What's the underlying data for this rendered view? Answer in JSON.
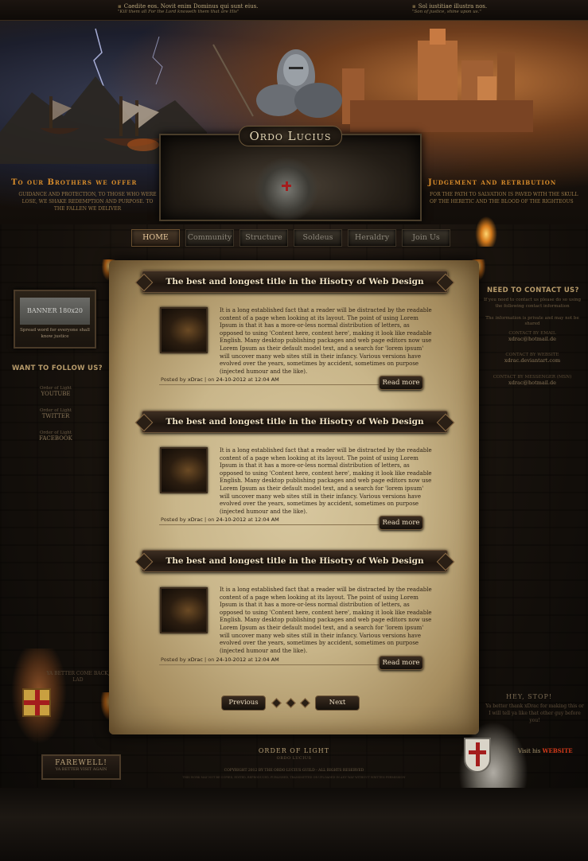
{
  "top_quotes": {
    "left": {
      "latin": "Caedite eos. Novit enim Dominus qui sunt eius.",
      "english": "\"Kill them all For the Lord knoweth them that are His\""
    },
    "right": {
      "latin": "Sol iustitiae illustra nos.",
      "english": "\"Son of justice, shine upon us.\""
    }
  },
  "logo": {
    "text": "Ordo Lucius"
  },
  "taglines": {
    "left": {
      "title": "To our Brothers we offer",
      "text": "Guidance and protection, to those who were lose, we shake redemption and purpose. To the fallen we deliver"
    },
    "right": {
      "title": "Judgement and retribution",
      "text": "For the path to salvation is paved with the skull of the heretic and the blood of the righteous"
    }
  },
  "nav": {
    "items": [
      {
        "label": "HOME",
        "active": true
      },
      {
        "label": "Community",
        "active": false
      },
      {
        "label": "Structure",
        "active": false
      },
      {
        "label": "Soldeus",
        "active": false
      },
      {
        "label": "Heraldry",
        "active": false
      },
      {
        "label": "Join Us",
        "active": false
      }
    ]
  },
  "posts": [
    {
      "title": "The best and longest title in the Hisotry of Web Design",
      "body": "It is a long established fact that a reader will be distracted by the readable content of a page when looking at its layout. The point of using Lorem Ipsum is that it has a more-or-less normal distribution of letters, as opposed to using 'Content here, content here', making it look like readable English. Many desktop publishing packages and web page editors now use Lorem Ipsum as their default model text, and a search for 'lorem ipsum' will uncover many web sites still in their infancy. Various versions have evolved over the years, sometimes by accident, sometimes on purpose (injected humour and the like).",
      "posted_by_label": "Posted by",
      "author": "xDrac",
      "on_label": "on",
      "date": "24-10-2012",
      "at_label": "at",
      "time": "12:04 AM",
      "read_more": "Read more"
    },
    {
      "title": "The best and longest title in the Hisotry of Web Design",
      "body": "It is a long established fact that a reader will be distracted by the readable content of a page when looking at its layout. The point of using Lorem Ipsum is that it has a more-or-less normal distribution of letters, as opposed to using 'Content here, content here', making it look like readable English. Many desktop publishing packages and web page editors now use Lorem Ipsum as their default model text, and a search for 'lorem ipsum' will uncover many web sites still in their infancy. Various versions have evolved over the years, sometimes by accident, sometimes on purpose (injected humour and the like).",
      "posted_by_label": "Posted by",
      "author": "xDrac",
      "on_label": "on",
      "date": "24-10-2012",
      "at_label": "at",
      "time": "12:04 AM",
      "read_more": "Read more"
    },
    {
      "title": "The best and longest title in the Hisotry of Web Design",
      "body": "It is a long established fact that a reader will be distracted by the readable content of a page when looking at its layout. The point of using Lorem Ipsum is that it has a more-or-less normal distribution of letters, as opposed to using 'Content here, content here', making it look like readable English. Many desktop publishing packages and web page editors now use Lorem Ipsum as their default model text, and a search for 'lorem ipsum' will uncover many web sites still in their infancy. Various versions have evolved over the years, sometimes by accident, sometimes on purpose (injected humour and the like).",
      "posted_by_label": "Posted by",
      "author": "xDrac",
      "on_label": "on",
      "date": "24-10-2012",
      "at_label": "at",
      "time": "12:04 AM",
      "read_more": "Read more"
    }
  ],
  "pagination": {
    "previous": "Previous",
    "next": "Next"
  },
  "left_sidebar": {
    "banner": {
      "label": "BANNER 180x20",
      "text": "Spread word for everyone shall know justice"
    },
    "follow_title": "WANT TO FOLLOW US?",
    "follow_items": [
      {
        "small": "Order of Light",
        "big": "YOUTUBE"
      },
      {
        "small": "Order of Light",
        "big": "TWITTER"
      },
      {
        "small": "Order of Light",
        "big": "FACEBOOK"
      }
    ],
    "better_text": "Ya better come back, lad",
    "farewell": {
      "title": "FAREWELL!",
      "sub": "Ya better visit again"
    }
  },
  "right_sidebar": {
    "contact_title": "NEED TO CONTACT US?",
    "contact_info": "If you need to contact us please do so using the following contact information",
    "contact_note": "The information is private and may not be shared",
    "contacts": [
      {
        "label": "Contact by email",
        "value": "xdrac@hotmail.de"
      },
      {
        "label": "Contact by website",
        "value": "xdrac.deviantart.com"
      },
      {
        "label": "Contact by messenger (MSN)",
        "value": "xdrac@hotmail.de"
      }
    ],
    "stop_title": "HEY, STOP!",
    "stop_text": "Ya better thank xDrac for making this or I will tell ya like that other guy before you!",
    "visit_prefix": "Visit his",
    "visit_link": "WEBSITE"
  },
  "footer": {
    "title": "ORDER OF LIGHT",
    "subtitle": "Ordo Lucius",
    "copyright": "Copyright 2012 by the Ordo Lucius Guild - All rights reserved",
    "legal": "This work may not be copied, edited, reproduced, published, transmitted or uploaded in any way without written permission"
  },
  "colors": {
    "accent": "#d68b2a",
    "parchment": "#c9b68a",
    "dark_button": "#15100b",
    "link_red": "#d33a1a"
  }
}
